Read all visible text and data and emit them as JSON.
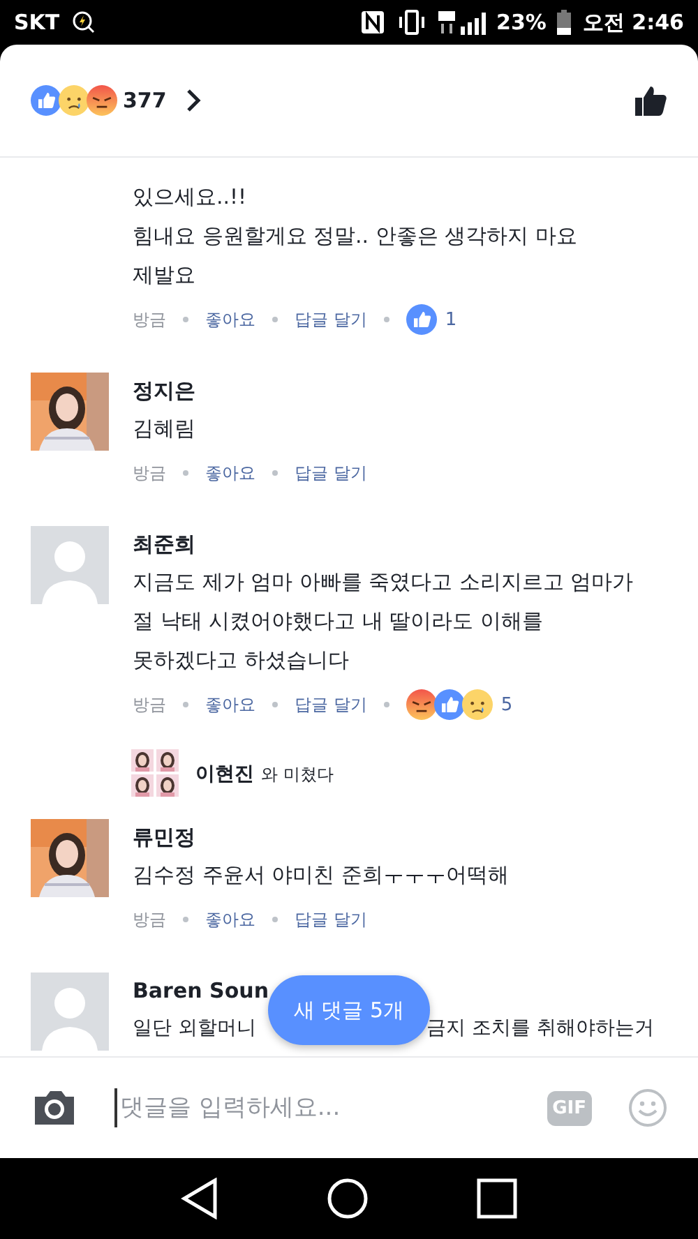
{
  "status_bar": {
    "carrier": "SKT",
    "battery": "23%",
    "time": "오전 2:46"
  },
  "header": {
    "reactions": [
      {
        "kind": "like"
      },
      {
        "kind": "sad"
      },
      {
        "kind": "angry"
      }
    ],
    "count": "377"
  },
  "comments": [
    {
      "kind": "comment",
      "body": "있으세요..!!\n힘내요 응원할게요 정말.. 안좋은 생각하지 마요\n제발요",
      "time": "방금",
      "like": "좋아요",
      "reply": "답글 달기",
      "reactions": [
        {
          "kind": "like"
        }
      ],
      "reaction_count": "1"
    },
    {
      "kind": "comment",
      "name": "정지은",
      "body": "김혜림",
      "time": "방금",
      "like": "좋아요",
      "reply": "답글 달기"
    },
    {
      "kind": "comment",
      "avatar": {
        "kind": "blank"
      },
      "name": "최준희",
      "body": "지금도 제가 엄마 아빠를 죽였다고 소리지르고 엄마가\n절 낙태 시켰어야했다고 내 딸이라도 이해를\n못하겠다고 하셨습니다",
      "time": "방금",
      "like": "좋아요",
      "reply": "답글 달기",
      "reactions": [
        {
          "kind": "angry"
        },
        {
          "kind": "like"
        },
        {
          "kind": "sad"
        }
      ],
      "reaction_count": "5"
    },
    {
      "kind": "reply_preview",
      "name": "이현진",
      "body": "와 미쳤다"
    },
    {
      "kind": "comment",
      "name": "류민정",
      "body": "김수정 주윤서 야미친 준희ㅜㅜㅜ어떡해",
      "time": "방금",
      "like": "좋아요",
      "reply": "답글 달기"
    },
    {
      "kind": "comment",
      "avatar": {
        "kind": "blank"
      },
      "name": "Baren Soun",
      "body_parts": [
        "일단 외할머니",
        "금지 조치를 취해야하는거"
      ]
    }
  ],
  "new_comments_button": "새 댓글 5개",
  "composer": {
    "placeholder": "댓글을 입력하세요...",
    "gif": "GIF"
  }
}
